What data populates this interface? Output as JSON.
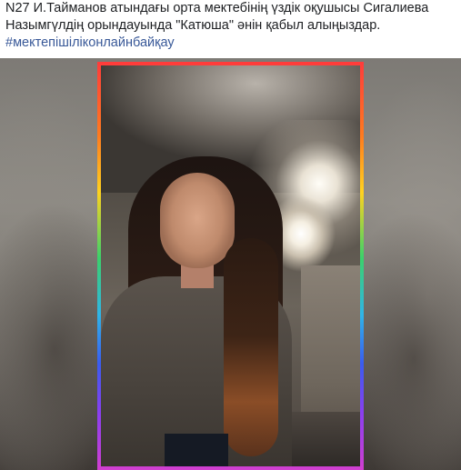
{
  "post": {
    "text_line1": "N27 И.Тайманов атындағы орта мектебінің үздік оқушысы Сигалиева",
    "text_line2": "Назымгүлдің орындауында \"Катюша\" әнін қабыл алыңыздар.",
    "hashtag": "#мектепішіліконлайнбайқау"
  },
  "colors": {
    "text": "#1c1e21",
    "hashtag": "#385898"
  },
  "media": {
    "type": "video-frame",
    "frame_style": "rainbow-border"
  }
}
